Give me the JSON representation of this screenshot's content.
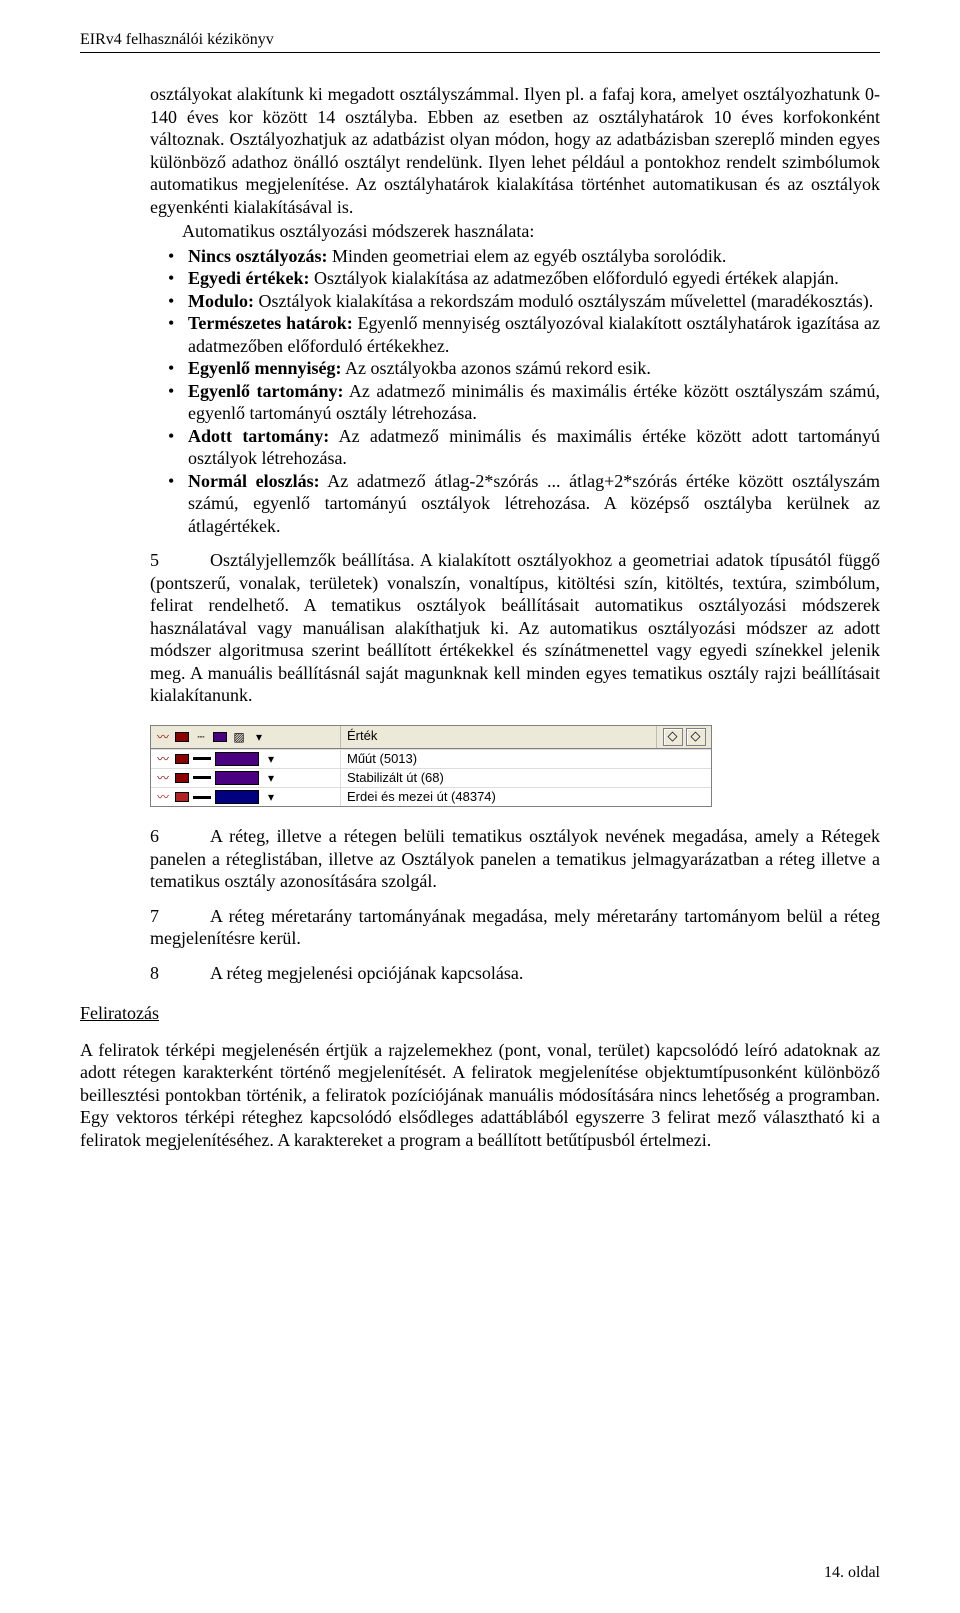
{
  "header": {
    "title": "EIRv4 felhasználói kézikönyv"
  },
  "intro": {
    "p1": "osztályokat alakítunk ki megadott osztályszámmal. Ilyen pl. a fafaj kora, amelyet osztályozhatunk 0-140 éves kor között 14 osztályba. Ebben az esetben az osztályhatárok 10 éves korfokonként változnak. Osztályozhatjuk az adatbázist olyan módon, hogy az adatbázisban szereplő minden egyes különböző adathoz önálló osztályt rendelünk. Ilyen lehet például a pontokhoz rendelt szimbólumok automatikus megjelenítése. Az osztályhatárok kialakítása történhet automatikusan és az osztályok egyenkénti kialakításával is.",
    "p2": "Automatikus osztályozási módszerek használata:"
  },
  "bullets": [
    {
      "bold": "Nincs osztályozás:",
      "rest": " Minden geometriai elem az egyéb osztályba sorolódik."
    },
    {
      "bold": "Egyedi értékek:",
      "rest": " Osztályok kialakítása az adatmezőben előforduló egyedi értékek alapján."
    },
    {
      "bold": "Modulo:",
      "rest": " Osztályok kialakítása a rekordszám moduló osztályszám művelettel (maradékosztás)."
    },
    {
      "bold": "Természetes határok:",
      "rest": " Egyenlő mennyiség osztályozóval kialakított osztályhatárok igazítása az adatmezőben előforduló értékekhez."
    },
    {
      "bold": "Egyenlő mennyiség:",
      "rest": " Az osztályokba azonos számú rekord esik."
    },
    {
      "bold": "Egyenlő tartomány:",
      "rest": " Az adatmező minimális és maximális értéke között osztályszám számú, egyenlő tartományú osztály létrehozása."
    },
    {
      "bold": "Adott tartomány:",
      "rest": " Az adatmező minimális és maximális értéke között adott tartományú osztályok létrehozása."
    },
    {
      "bold": "Normál eloszlás:",
      "rest": " Az adatmező átlag-2*szórás ... átlag+2*szórás értéke között osztályszám számú, egyenlő tartományú osztályok létrehozása. A középső osztályba kerülnek az átlagértékek."
    }
  ],
  "para5": {
    "num": "5",
    "text": "Osztályjellemzők beállítása. A kialakított osztályokhoz a geometriai adatok típusától függő (pontszerű, vonalak, területek) vonalszín, vonaltípus, kitöltési szín, kitöltés, textúra, szimbólum, felirat rendelhető. A tematikus osztályok beállításait automatikus osztályozási módszerek használatával vagy manuálisan alakíthatjuk ki. Az automatikus osztályozási módszer az adott módszer algoritmusa szerint beállított értékekkel és színátmenettel vagy egyedi színekkel jelenik meg. A manuális beállításnál saját magunknak kell minden egyes tematikus osztály rajzi beállításait kialakítanunk."
  },
  "ui": {
    "header": {
      "col_title": "Érték"
    },
    "swatches": {
      "head_left_a": "#8B0000",
      "head_left_b": "#4B0082",
      "row1_a": "#8B0000",
      "row1_b": "#4B0082",
      "row1_big": "#4B0082",
      "row2_a": "#8B0000",
      "row2_b": "#4B0082",
      "row2_big": "#4B0082",
      "row3_a": "#B22222",
      "row3_b": "#000080",
      "row3_big": "#000080"
    },
    "rows": [
      {
        "value": "Műút (5013)"
      },
      {
        "value": "Stabilizált út (68)"
      },
      {
        "value": "Erdei és mezei út (48374)"
      }
    ]
  },
  "para6": {
    "num": "6",
    "text": "A réteg, illetve a rétegen belüli tematikus osztályok nevének megadása, amely a Rétegek panelen a réteglistában, illetve az Osztályok panelen a tematikus jelmagyarázatban a réteg illetve a tematikus osztály azonosítására szolgál."
  },
  "para7": {
    "num": "7",
    "text": "A réteg méretarány tartományának megadása, mely méretarány tartományom belül a réteg megjelenítésre kerül."
  },
  "para8": {
    "num": "8",
    "text": "A réteg megjelenési opciójának kapcsolása."
  },
  "section": {
    "heading": "Feliratozás",
    "body": "A feliratok térképi megjelenésén értjük a rajzelemekhez (pont, vonal, terület) kapcsolódó leíró adatoknak az adott rétegen karakterként történő megjelenítését. A feliratok megjelenítése objektumtípusonként különböző beillesztési pontokban történik, a feliratok pozíciójának manuális módosítására nincs lehetőség a programban. Egy vektoros térképi réteghez kapcsolódó elsődleges adattáblából egyszerre 3 felirat mező választható ki a feliratok megjelenítéséhez. A karaktereket a program a beállított betűtípusból értelmezi."
  },
  "footer": {
    "page": "14. oldal"
  }
}
